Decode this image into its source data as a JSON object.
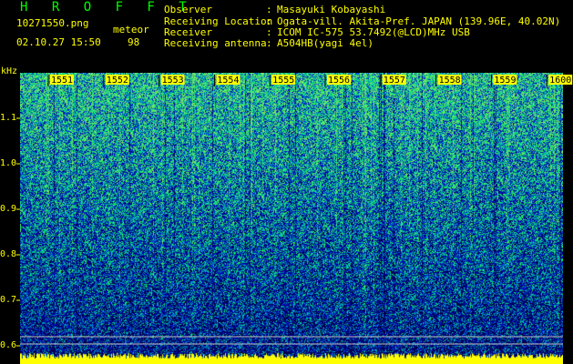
{
  "header": {
    "app_title": "H R O F F T",
    "filename": "10271550.png",
    "meteor_label": "meteor",
    "datetime": "02.10.27 15:50",
    "meteor_count": "98"
  },
  "info": [
    {
      "label": "Observer",
      "value": "Masayuki Kobayashi"
    },
    {
      "label": "Receiving Location",
      "value": "Ogata-vill. Akita-Pref. JAPAN (139.96E, 40.02N)"
    },
    {
      "label": "Receiver",
      "value": "ICOM IC-575 53.7492(@LCD)MHz USB"
    },
    {
      "label": "Receiving antenna",
      "value": "A504HB(yagi 4el)"
    }
  ],
  "axis": {
    "y_unit": "kHz",
    "y_ticks": [
      "1.1",
      "1.0",
      "0.9",
      "0.8",
      "0.7",
      "0.6"
    ],
    "x_ticks": [
      "1551",
      "1552",
      "1553",
      "1554",
      "1555",
      "1556",
      "1557",
      "1558",
      "1559",
      "1600"
    ]
  },
  "colors": {
    "text_yellow": "#ffff00",
    "text_green": "#00ff00",
    "bg": "#000000"
  }
}
